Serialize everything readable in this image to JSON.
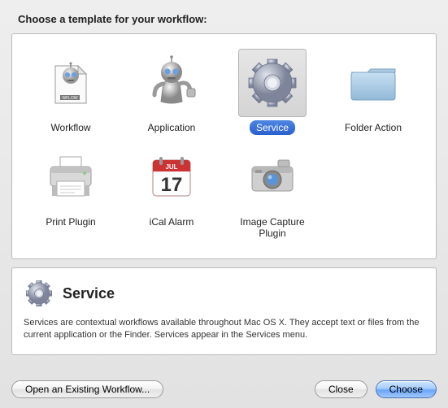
{
  "dialog": {
    "title": "Choose a template for your workflow:"
  },
  "templates": [
    {
      "id": "workflow",
      "label": "Workflow",
      "selected": false
    },
    {
      "id": "application",
      "label": "Application",
      "selected": false
    },
    {
      "id": "service",
      "label": "Service",
      "selected": true
    },
    {
      "id": "folderaction",
      "label": "Folder Action",
      "selected": false
    },
    {
      "id": "printplugin",
      "label": "Print Plugin",
      "selected": false
    },
    {
      "id": "icalalarm",
      "label": "iCal Alarm",
      "selected": false
    },
    {
      "id": "imagecapture",
      "label": "Image Capture Plugin",
      "selected": false
    }
  ],
  "description": {
    "title": "Service",
    "text": "Services are contextual workflows available throughout Mac OS X. They accept text or files from the current application or the Finder. Services appear in the Services menu."
  },
  "buttons": {
    "open_existing": "Open an Existing Workflow...",
    "close": "Close",
    "choose": "Choose"
  }
}
